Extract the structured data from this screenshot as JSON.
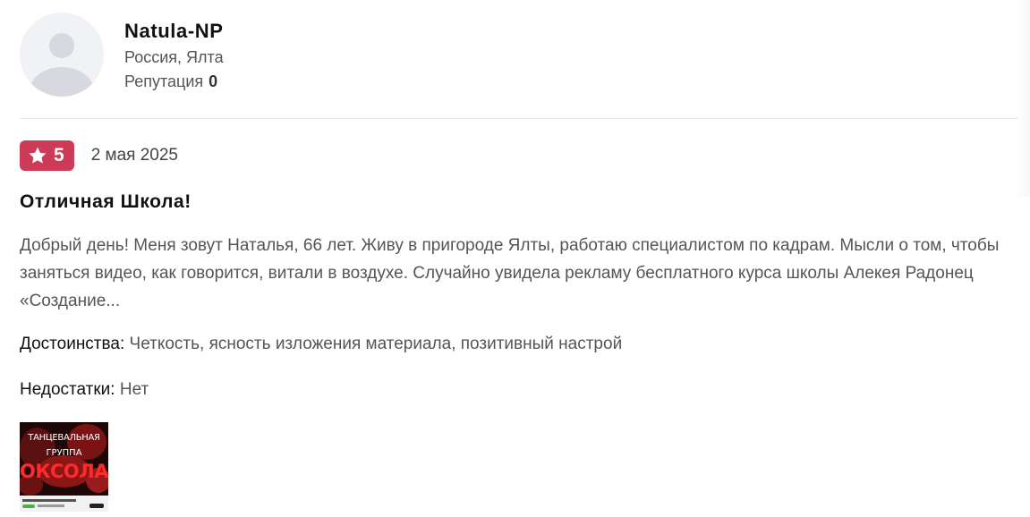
{
  "author": {
    "name": "Natula-NP",
    "location": "Россия, Ялта",
    "reputation_label": "Репутация",
    "reputation_value": "0",
    "avatar_icon": "user-placeholder-icon"
  },
  "review": {
    "rating": "5",
    "rating_icon": "star-icon",
    "rating_color": "#cc3b57",
    "date": "2 мая 2025",
    "title": "Отличная Школа!",
    "text": "Добрый день! Меня зовут Наталья, 66 лет. Живу в пригороде Ялты, работаю специалистом по кадрам. Мысли о том, чтобы заняться видео, как говорится, витали в воздухе. Случайно увидела рекламу бесплатного курса школы Алекея Радонец «Создание...",
    "pros_label": "Достоинства:",
    "pros": "Четкость, ясность изложения материала, позитивный настрой",
    "cons_label": "Недостатки:",
    "cons": "Нет",
    "photo": {
      "line1": "ТАНЦЕВАЛЬНАЯ",
      "line2": "ГРУППА",
      "line3": "ОКСОЛАН"
    }
  }
}
